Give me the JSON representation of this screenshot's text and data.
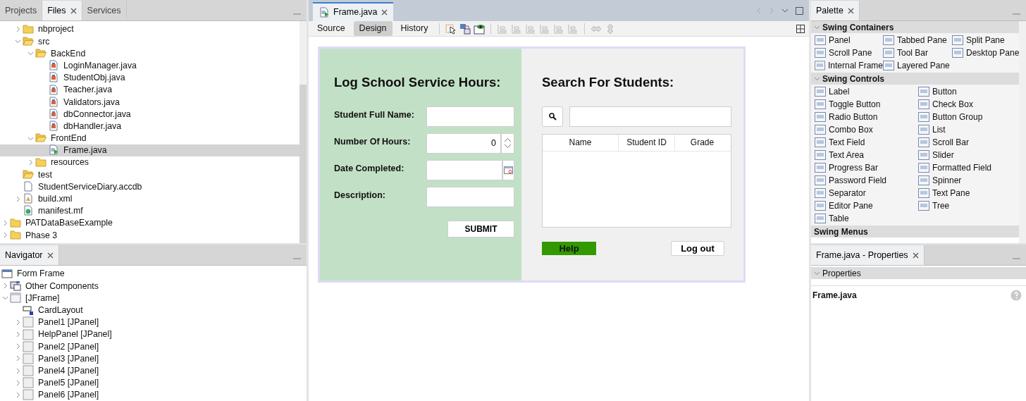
{
  "files_panel": {
    "tabs": [
      {
        "label": "Projects",
        "selected": false,
        "closable": false
      },
      {
        "label": "Files",
        "selected": true,
        "closable": true
      },
      {
        "label": "Services",
        "selected": false,
        "closable": false
      }
    ],
    "tree": [
      {
        "children": [
          {
            "label": "nbproject",
            "kind": "folder",
            "expanded": false,
            "selected": false
          },
          {
            "label": "src",
            "kind": "folder",
            "expanded": true,
            "selected": false,
            "children": [
              {
                "label": "BackEnd",
                "kind": "folder",
                "expanded": true,
                "selected": false,
                "children": [
                  {
                    "label": "LoginManager.java",
                    "kind": "java",
                    "selected": false
                  },
                  {
                    "label": "StudentObj.java",
                    "kind": "java",
                    "selected": false
                  },
                  {
                    "label": "Teacher.java",
                    "kind": "java",
                    "selected": false
                  },
                  {
                    "label": "Validators.java",
                    "kind": "java",
                    "selected": false
                  },
                  {
                    "label": "dbConnector.java",
                    "kind": "java",
                    "selected": false
                  },
                  {
                    "label": "dbHandler.java",
                    "kind": "java",
                    "selected": false
                  }
                ]
              },
              {
                "label": "FrontEnd",
                "kind": "folder",
                "expanded": true,
                "selected": false,
                "children": [
                  {
                    "label": "Frame.java",
                    "kind": "form",
                    "selected": true
                  }
                ]
              },
              {
                "label": "resources",
                "kind": "folder",
                "expanded": false,
                "selected": false
              }
            ]
          },
          {
            "label": "test",
            "kind": "folder",
            "selected": false,
            "open": true
          },
          {
            "label": "StudentServiceDiary.accdb",
            "kind": "file",
            "selected": false
          },
          {
            "label": "build.xml",
            "kind": "xml",
            "expanded": false,
            "selected": false
          },
          {
            "label": "manifest.mf",
            "kind": "manifest",
            "selected": false
          }
        ]
      },
      {
        "label": "PATDataBaseExample",
        "kind": "folder",
        "expanded": false,
        "selected": false
      },
      {
        "label": "Phase 3",
        "kind": "folder",
        "expanded": false,
        "selected": false
      }
    ]
  },
  "navigator": {
    "tab": {
      "label": "Navigator",
      "closable": true
    },
    "root": {
      "label": "Form Frame",
      "kind": "form-root",
      "children": [
        {
          "label": "Other Components",
          "kind": "components",
          "expanded": false
        },
        {
          "label": "[JFrame]",
          "kind": "frame",
          "expanded": true,
          "children": [
            {
              "label": "CardLayout",
              "kind": "layout"
            },
            {
              "label": "Panel1 [JPanel]",
              "kind": "panel",
              "expanded": false
            },
            {
              "label": "HelpPanel [JPanel]",
              "kind": "panel",
              "expanded": false
            },
            {
              "label": "Panel2 [JPanel]",
              "kind": "panel",
              "expanded": false
            },
            {
              "label": "Panel3 [JPanel]",
              "kind": "panel",
              "expanded": false
            },
            {
              "label": "Panel4 [JPanel]",
              "kind": "panel",
              "expanded": false
            },
            {
              "label": "Panel5 [JPanel]",
              "kind": "panel",
              "expanded": false
            },
            {
              "label": "Panel6 [JPanel]",
              "kind": "panel",
              "expanded": false
            }
          ]
        }
      ]
    }
  },
  "editor": {
    "tab": {
      "label": "Frame.java",
      "closable": true
    },
    "views": [
      {
        "label": "Source",
        "selected": false
      },
      {
        "label": "Design",
        "selected": true
      },
      {
        "label": "History",
        "selected": false
      }
    ],
    "form": {
      "log_panel": {
        "title": "Log School Service Hours:",
        "fields": [
          {
            "label": "Student Full Name:",
            "kind": "text"
          },
          {
            "label": "Number Of Hours:",
            "kind": "spinner",
            "value": "0"
          },
          {
            "label": "Date Completed:",
            "kind": "date"
          },
          {
            "label": "Description:",
            "kind": "text"
          }
        ],
        "submit": "SUBMIT"
      },
      "search_panel": {
        "title": "Search For Students:",
        "columns": [
          "Name",
          "Student ID",
          "Grade"
        ],
        "help": "Help",
        "logout": "Log out"
      }
    }
  },
  "palette": {
    "tab": {
      "label": "Palette",
      "closable": true
    },
    "sections": [
      {
        "title": "Swing Containers",
        "expanded": true,
        "items": [
          "Panel",
          "Tabbed Pane",
          "Split Pane",
          "Scroll Pane",
          "Tool Bar",
          "Desktop Pane",
          "Internal Frame",
          "Layered Pane"
        ]
      },
      {
        "title": "Swing Controls",
        "expanded": true,
        "items": [
          "Label",
          "Button",
          "Toggle Button",
          "Check Box",
          "Radio Button",
          "Button Group",
          "Combo Box",
          "List",
          "Text Field",
          "Scroll Bar",
          "Text Area",
          "Slider",
          "Progress Bar",
          "Formatted Field",
          "Password Field",
          "Spinner",
          "Separator",
          "Text Pane",
          "Editor Pane",
          "Tree",
          "Table"
        ]
      },
      {
        "title": "Swing Menus"
      }
    ]
  },
  "properties": {
    "tab": {
      "label": "Frame.java - Properties",
      "closable": true
    },
    "section": {
      "title": "Properties",
      "expanded": true
    },
    "node": "Frame.java"
  }
}
